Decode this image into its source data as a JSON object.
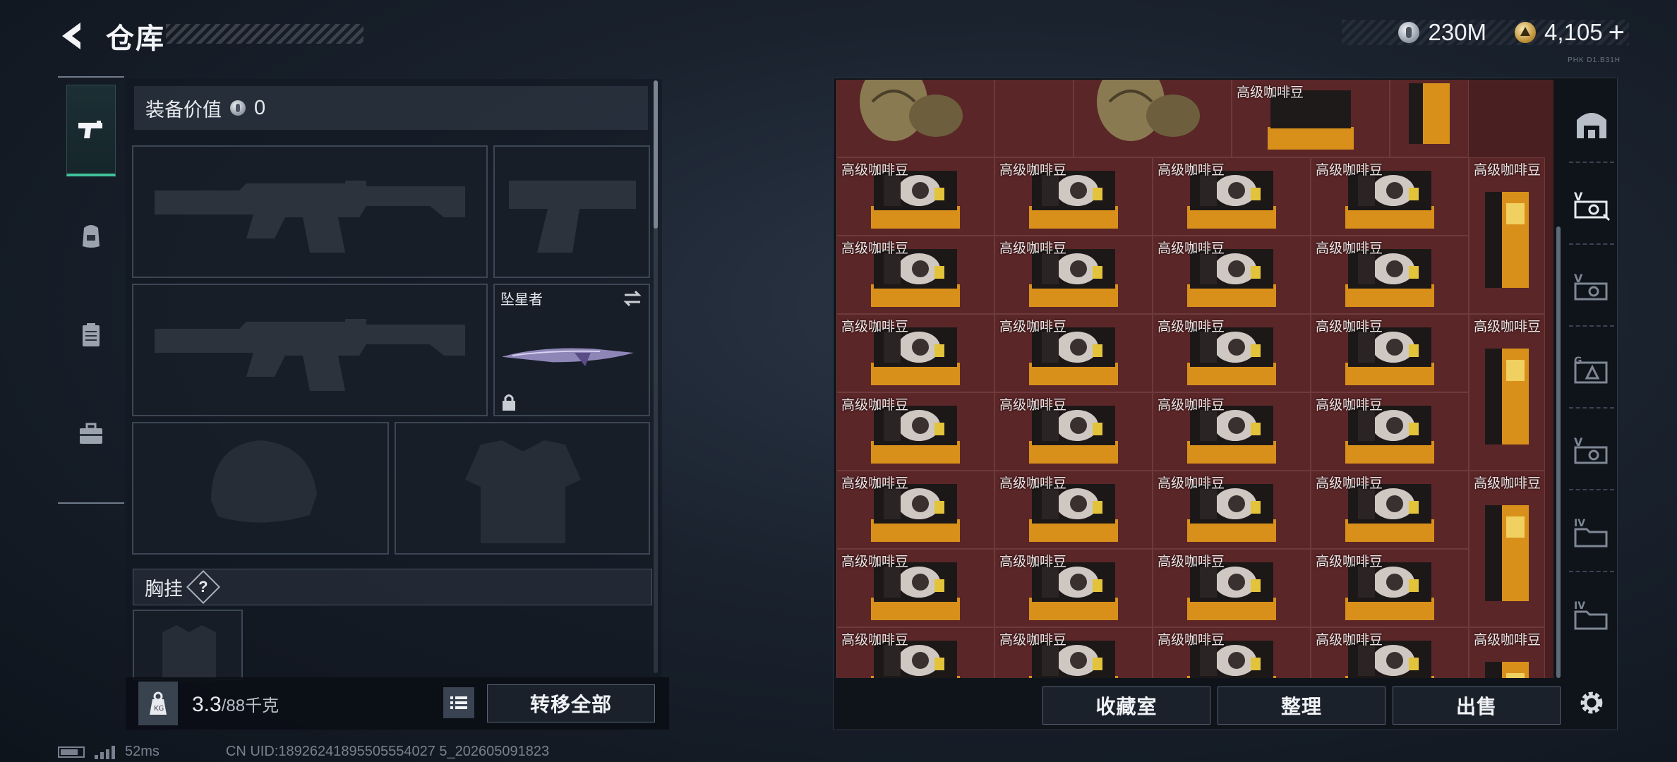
{
  "header": {
    "title": "仓库",
    "currency_silver": "230M",
    "currency_gold": "4,105",
    "plus_label": "+",
    "tiny_text": "PHK D1.B31H"
  },
  "equipment": {
    "value_label": "装备价值",
    "value_amount": "0",
    "melee_slot_name": "坠星者",
    "chest_rig_title": "胸挂",
    "help_label": "?"
  },
  "weight": {
    "current": "3.3",
    "max": "/88千克",
    "transfer_all_label": "转移全部"
  },
  "storage": {
    "item_label": "高级咖啡豆",
    "buttons": {
      "collection": "收藏室",
      "organize": "整理",
      "sell": "出售"
    }
  },
  "status": {
    "ping": "52ms",
    "uid": "CN UID:18926241895505554027 5_202605091823"
  },
  "colors": {
    "accent": "#41c29a",
    "cell_bg": "#5b2628",
    "panel_bg": "#121820"
  },
  "icons": {
    "category_rail": [
      "pistol-icon",
      "backpack-icon",
      "clipboard-icon",
      "toolbox-icon"
    ],
    "right_rail": [
      "safe-icon",
      "card-v1-icon",
      "card-v2-icon",
      "card-g-icon",
      "card-v3-icon",
      "crate-iv-icon",
      "crate-iv2-icon"
    ]
  }
}
